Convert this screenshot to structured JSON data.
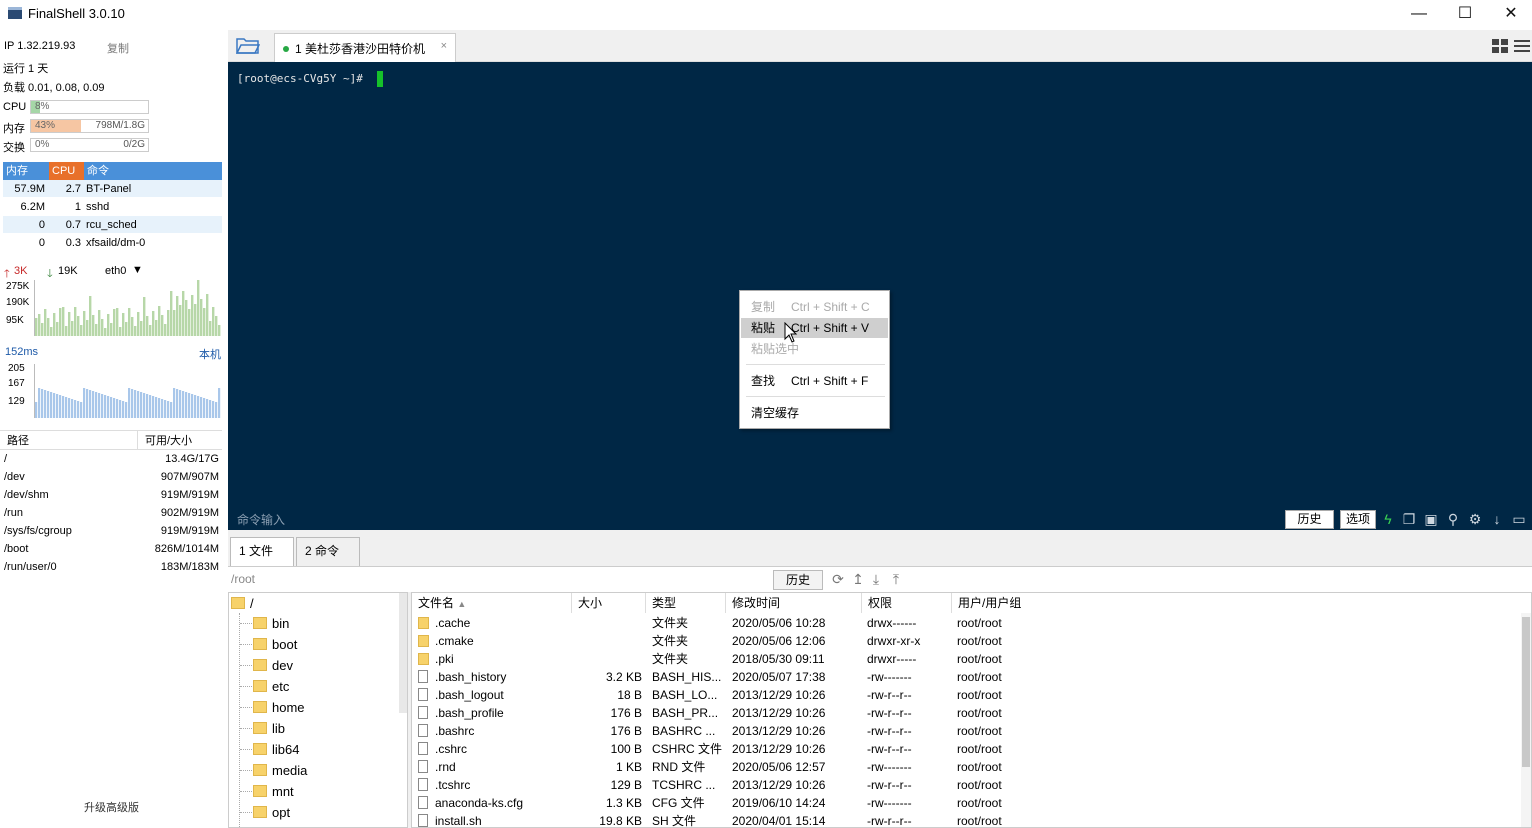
{
  "window": {
    "title": "FinalShell 3.0.10",
    "controls": [
      "—",
      "☐",
      "✕"
    ]
  },
  "sysinfo": {
    "ip": "IP 1.32.219.93",
    "copy": "复制",
    "uptime": "运行 1 天",
    "load": "负载 0.01, 0.08, 0.09",
    "cpu_label": "CPU",
    "cpu_value": "8%",
    "cpu_fraction": 0.08,
    "mem_label": "内存",
    "mem_value": "43%",
    "mem_fraction": 0.43,
    "mem_detail": "798M/1.8G",
    "swap_label": "交换",
    "swap_value": "0%",
    "swap_fraction": 0,
    "swap_detail": "0/2G"
  },
  "processes": {
    "headers": [
      "内存",
      "CPU",
      "命令"
    ],
    "rows": [
      {
        "mem": "57.9M",
        "cpu": "2.7",
        "cmd": "BT-Panel"
      },
      {
        "mem": "6.2M",
        "cpu": "1",
        "cmd": "sshd"
      },
      {
        "mem": "0",
        "cpu": "0.7",
        "cmd": "rcu_sched"
      },
      {
        "mem": "0",
        "cpu": "0.3",
        "cmd": "xfsaild/dm-0"
      }
    ]
  },
  "network": {
    "up": "3K",
    "down": "19K",
    "iface": "eth0",
    "y_ticks": [
      "275K",
      "190K",
      "95K"
    ],
    "latency": "152ms",
    "host": "本机",
    "lat_ticks": [
      "205",
      "167",
      "129"
    ]
  },
  "disks": {
    "headers": [
      "路径",
      "可用/大小"
    ],
    "rows": [
      {
        "path": "/",
        "size": "13.4G/17G"
      },
      {
        "path": "/dev",
        "size": "907M/907M"
      },
      {
        "path": "/dev/shm",
        "size": "919M/919M"
      },
      {
        "path": "/run",
        "size": "902M/919M"
      },
      {
        "path": "/sys/fs/cgroup",
        "size": "919M/919M"
      },
      {
        "path": "/boot",
        "size": "826M/1014M"
      },
      {
        "path": "/run/user/0",
        "size": "183M/183M"
      }
    ]
  },
  "upgrade": "升级高级版",
  "tab": {
    "label": "1 美杜莎香港沙田特价机",
    "close": "×"
  },
  "terminal": {
    "prompt": "[root@ecs-CVg5Y ~]#",
    "cmd_input": "命令输入",
    "history_btn": "历史",
    "options_btn": "选项"
  },
  "context_menu": {
    "items": [
      {
        "label": "复制",
        "shortcut": "Ctrl + Shift + C",
        "state": "disabled"
      },
      {
        "label": "粘贴",
        "shortcut": "Ctrl + Shift + V",
        "state": "hover"
      },
      {
        "label": "粘贴选中",
        "shortcut": "",
        "state": "disabled"
      },
      {
        "label": "查找",
        "shortcut": "Ctrl + Shift + F",
        "state": "normal"
      },
      {
        "label": "清空缓存",
        "shortcut": "",
        "state": "normal"
      }
    ]
  },
  "bottom": {
    "tab_files": "1 文件",
    "tab_commands": "2 命令",
    "path": "/root",
    "history_btn": "历史"
  },
  "tree": {
    "root": "/",
    "items": [
      "bin",
      "boot",
      "dev",
      "etc",
      "home",
      "lib",
      "lib64",
      "media",
      "mnt",
      "opt"
    ]
  },
  "files": {
    "headers": [
      "文件名",
      "大小",
      "类型",
      "修改时间",
      "权限",
      "用户/用户组"
    ],
    "rows": [
      {
        "name": ".cache",
        "size": "",
        "type": "文件夹",
        "mtime": "2020/05/06 10:28",
        "perm": "drwx------",
        "owner": "root/root",
        "dir": true
      },
      {
        "name": ".cmake",
        "size": "",
        "type": "文件夹",
        "mtime": "2020/05/06 12:06",
        "perm": "drwxr-xr-x",
        "owner": "root/root",
        "dir": true
      },
      {
        "name": ".pki",
        "size": "",
        "type": "文件夹",
        "mtime": "2018/05/30 09:11",
        "perm": "drwxr-----",
        "owner": "root/root",
        "dir": true
      },
      {
        "name": ".bash_history",
        "size": "3.2 KB",
        "type": "BASH_HIS...",
        "mtime": "2020/05/07 17:38",
        "perm": "-rw-------",
        "owner": "root/root",
        "dir": false
      },
      {
        "name": ".bash_logout",
        "size": "18 B",
        "type": "BASH_LO...",
        "mtime": "2013/12/29 10:26",
        "perm": "-rw-r--r--",
        "owner": "root/root",
        "dir": false
      },
      {
        "name": ".bash_profile",
        "size": "176 B",
        "type": "BASH_PR...",
        "mtime": "2013/12/29 10:26",
        "perm": "-rw-r--r--",
        "owner": "root/root",
        "dir": false
      },
      {
        "name": ".bashrc",
        "size": "176 B",
        "type": "BASHRC ...",
        "mtime": "2013/12/29 10:26",
        "perm": "-rw-r--r--",
        "owner": "root/root",
        "dir": false
      },
      {
        "name": ".cshrc",
        "size": "100 B",
        "type": "CSHRC 文件",
        "mtime": "2013/12/29 10:26",
        "perm": "-rw-r--r--",
        "owner": "root/root",
        "dir": false
      },
      {
        "name": ".rnd",
        "size": "1 KB",
        "type": "RND 文件",
        "mtime": "2020/05/06 12:57",
        "perm": "-rw-------",
        "owner": "root/root",
        "dir": false
      },
      {
        "name": ".tcshrc",
        "size": "129 B",
        "type": "TCSHRC ...",
        "mtime": "2013/12/29 10:26",
        "perm": "-rw-r--r--",
        "owner": "root/root",
        "dir": false
      },
      {
        "name": "anaconda-ks.cfg",
        "size": "1.3 KB",
        "type": "CFG 文件",
        "mtime": "2019/06/10 14:24",
        "perm": "-rw-------",
        "owner": "root/root",
        "dir": false
      },
      {
        "name": "install.sh",
        "size": "19.8 KB",
        "type": "SH 文件",
        "mtime": "2020/04/01 15:14",
        "perm": "-rw-r--r--",
        "owner": "root/root",
        "dir": false
      }
    ]
  }
}
